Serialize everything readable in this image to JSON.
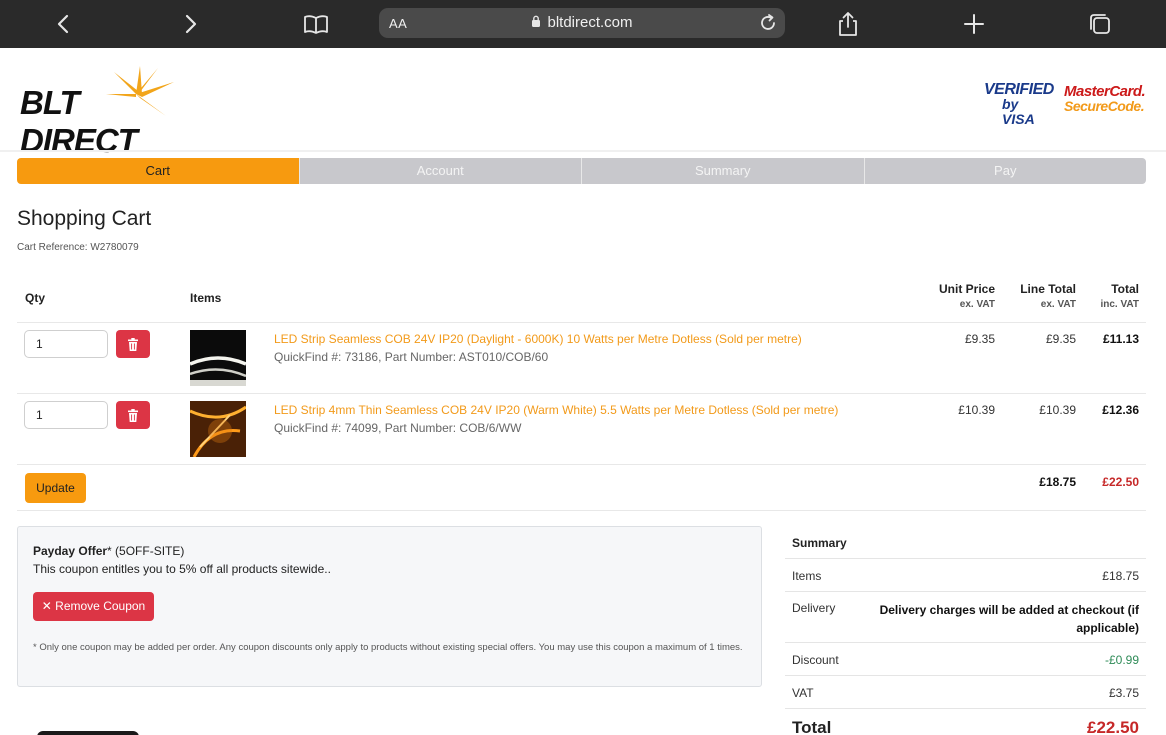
{
  "browser": {
    "aa_label": "AA",
    "url": "bltdirect.com"
  },
  "brand": {
    "logo_text": "BLT DIRECT",
    "visa_line1": "VERIFIED",
    "visa_line2": "by VISA",
    "mc_line1": "MasterCard.",
    "mc_line2": "SecureCode."
  },
  "steps": [
    {
      "label": "Cart",
      "active": true
    },
    {
      "label": "Account",
      "active": false
    },
    {
      "label": "Summary",
      "active": false
    },
    {
      "label": "Pay",
      "active": false
    }
  ],
  "page": {
    "title": "Shopping Cart",
    "cart_reference": "Cart Reference: W2780079"
  },
  "table": {
    "headers": {
      "qty": "Qty",
      "items": "Items",
      "unit_price": "Unit Price",
      "unit_price_sub": "ex. VAT",
      "line_total": "Line Total",
      "line_total_sub": "ex. VAT",
      "total": "Total",
      "total_sub": "inc. VAT"
    },
    "rows": [
      {
        "qty": "1",
        "name": "LED Strip Seamless COB 24V IP20 (Daylight - 6000K) 10 Watts per Metre Dotless (Sold per metre)",
        "meta": "QuickFind #: 73186, Part Number: AST010/COB/60",
        "unit_price": "£9.35",
        "line_total": "£9.35",
        "total": "£11.13"
      },
      {
        "qty": "1",
        "name": "LED Strip 4mm Thin Seamless COB 24V IP20 (Warm White) 5.5 Watts per Metre Dotless (Sold per metre)",
        "meta": "QuickFind #: 74099, Part Number: COB/6/WW",
        "unit_price": "£10.39",
        "line_total": "£10.39",
        "total": "£12.36"
      }
    ],
    "update_label": "Update",
    "subtotal_ex_vat": "£18.75",
    "subtotal_inc_vat": "£22.50"
  },
  "coupon": {
    "title": "Payday Offer",
    "code": "* (5OFF-SITE)",
    "description": "This coupon entitles you to 5% off all products sitewide..",
    "remove_label": "Remove Coupon",
    "note": "* Only one coupon may be added per order. Any coupon discounts only apply to products without existing special offers. You may use this coupon a maximum of 1 times."
  },
  "summary": {
    "title": "Summary",
    "items_label": "Items",
    "items_value": "£18.75",
    "delivery_label": "Delivery",
    "delivery_value": "Delivery charges will be added at checkout (if applicable)",
    "discount_label": "Discount",
    "discount_value": "-£0.99",
    "vat_label": "VAT",
    "vat_value": "£3.75",
    "total_label": "Total",
    "total_value": "£22.50"
  },
  "colors": {
    "accent": "#f79a0f",
    "danger": "#dc3545",
    "link": "#f29a1a",
    "discount": "#2e8b57",
    "total": "#c62828"
  }
}
